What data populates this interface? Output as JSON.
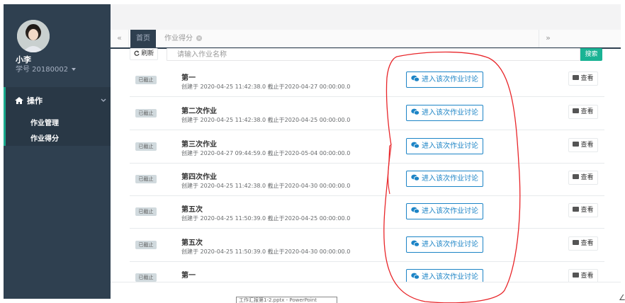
{
  "sidebar": {
    "user_name": "小李",
    "user_id": "学号 20180002",
    "nav_title": "操作",
    "nav_items": [
      "作业管理",
      "作业得分"
    ]
  },
  "tabs": {
    "left_arrow": "«",
    "right_arrow": "»",
    "home": "首页",
    "score": "作业得分"
  },
  "toolbar": {
    "refresh_label": "刷新",
    "search_placeholder": "请输入作业名称",
    "search_label": "搜索"
  },
  "list": {
    "items": [
      {
        "status": "已截止",
        "title": "第一",
        "meta": "创建于 2020-04-25 11:42:38.0 截止于2020-04-27 00:00:00.0",
        "discuss": "进入该次作业讨论",
        "view": "查看"
      },
      {
        "status": "已截止",
        "title": "第二次作业",
        "meta": "创建于 2020-04-25 11:42:38.0 截止于2020-04-25 00:00:00.0",
        "discuss": "进入该次作业讨论",
        "view": "查看"
      },
      {
        "status": "已截止",
        "title": "第三次作业",
        "meta": "创建于 2020-04-27 09:44:59.0 截止于2020-05-04 00:00:00.0",
        "discuss": "进入该次作业讨论",
        "view": "查看"
      },
      {
        "status": "已截止",
        "title": "第四次作业",
        "meta": "创建于 2020-04-25 11:42:38.0 截止于2020-04-30 00:00:00.0",
        "discuss": "进入该次作业讨论",
        "view": "查看"
      },
      {
        "status": "已截止",
        "title": "第五次",
        "meta": "创建于 2020-04-25 11:50:39.0 截止于2020-04-25 00:00:00.0",
        "discuss": "进入该次作业讨论",
        "view": "查看"
      },
      {
        "status": "已截止",
        "title": "第五次",
        "meta": "创建于 2020-04-25 11:50:39.0 截止于2020-04-30 00:00:00.0",
        "discuss": "进入该次作业讨论",
        "view": "查看"
      },
      {
        "status": "已截止",
        "title": "第一",
        "meta": "",
        "discuss": "进入该次作业讨论",
        "view": "查看"
      }
    ]
  },
  "footer": {
    "taskbar_tip": "工作汇报第1-2.pptx - PowerPoint",
    "corner_mark": "∠"
  },
  "colors": {
    "sidebar": "#2f4050",
    "accent": "#1ab394",
    "primary_outline": "#1c84c6",
    "annotation": "#e8262a"
  },
  "icons": [
    "user-avatar",
    "home-icon",
    "chevron-down-icon",
    "refresh-icon",
    "wechat-icon",
    "folder-icon",
    "close-icon"
  ]
}
